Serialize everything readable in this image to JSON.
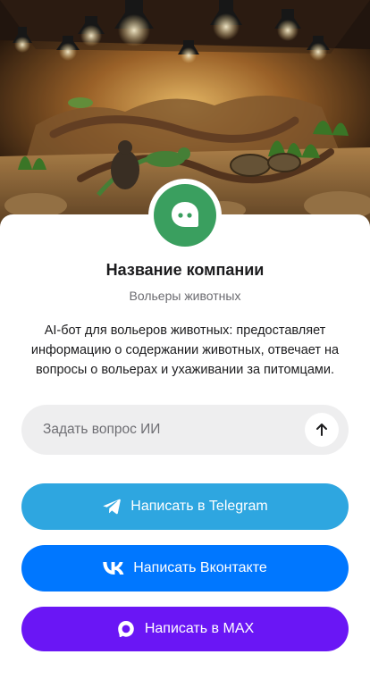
{
  "company": {
    "name": "Название компании",
    "category": "Вольеры животных",
    "description": "AI-бот для вольеров животных: предоставляет информацию о содержании животных, отвечает на вопросы о вольерах и ухаживании за питомцами."
  },
  "ask": {
    "placeholder": "Задать вопрос ИИ",
    "value": ""
  },
  "buttons": {
    "telegram": {
      "label": "Написать в Telegram",
      "icon": "telegram-icon",
      "color": "#2ea6e0"
    },
    "vk": {
      "label": "Написать Вконтакте",
      "icon": "vk-icon",
      "color": "#0077ff"
    },
    "max": {
      "label": "Написать в MAX",
      "icon": "max-icon",
      "color": "#6a16f5"
    }
  },
  "colors": {
    "avatar": "#3a9f5f",
    "input_bg": "#eeeeef"
  },
  "hero": {
    "image": "reptile-terrarium-photo"
  }
}
